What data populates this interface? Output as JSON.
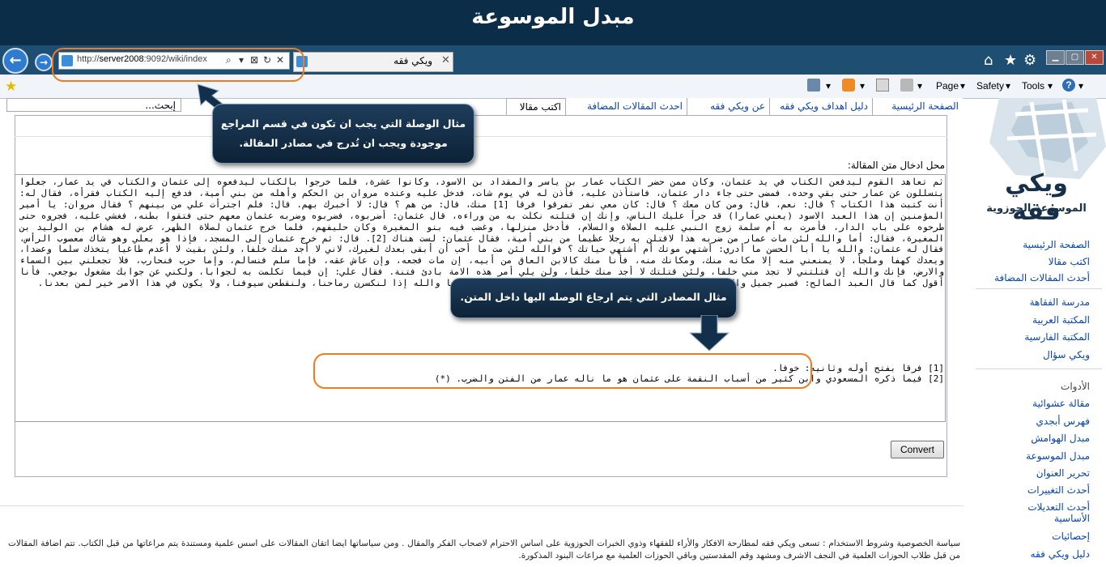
{
  "banner": {
    "title": "مبدل الموسوعة"
  },
  "browser": {
    "address_url_prefix": "http://",
    "address_url_host": "server2008",
    "address_url_rest": ":9092/wiki/index",
    "address_tools": [
      "⌕",
      "▾",
      "⊠",
      "↻",
      "✕"
    ],
    "tab_title": "ويكي فقه",
    "tab_close": "✕",
    "window_controls": [
      "▁",
      "▢",
      "✕"
    ],
    "commands": {
      "page_label": "Page",
      "safety_label": "Safety",
      "tools_label": "Tools",
      "help_label": "?",
      "dropdown_glyph": "▾"
    }
  },
  "logo": {
    "main": "ويكي فقه",
    "sub": "الموسوعة الحوزوية"
  },
  "search": {
    "value": "إبحث..."
  },
  "page_tabs": [
    {
      "label": "الصفحة الرئيسية"
    },
    {
      "label": "دليل اهداف ويكي فقه"
    },
    {
      "label": "عن ويكي فقه"
    },
    {
      "label": "احدث المقالات المضافة"
    },
    {
      "label": "اكتب مقالا"
    }
  ],
  "editor": {
    "field_label": "محل ادخال متن المقالة:",
    "article_text": "ثم تعاهد القوم ليدفعن الكتاب في يد عثمان، وكان ممن حضر الكتاب عمار بن ياسر والمقداد بن الاسود، وكانوا عشرة، فلما خرجوا بالكتاب ليدفعوه إلى عثمان والكتاب في يد عمار، جعلوا يتسللون عن عمار حتى بقي وحده، فمضى حتى جاء دار عثمان، فاستأذن عليه، فأذن له في يوم شات، فدخل عليه وعنده مروان بن الحكم وأهله من بني أمية، فدفع إليه الكتاب فقرأه، فقال له: أنت كتبت هذا الكتاب ؟ قال: نعم، قال: ومن كان معك ؟ قال: كان معي نفر تفرقوا فرقا [1] منك، قال: من هم ؟ قال: لا أخبرك بهم. قال: فلم اجترأت علي من بينهم ؟ فقال مروان: يا أمير المؤمنين إن هذا العبد الاسود (يعني عمارا) قد جرأ عليك الناس، وإنك إن قتلته نكلت به من وراءه، قال عثمان: أضربوه، فضربوه وضربه عثمان معهم حتى فتقوا بطنه، فغشي عليه، فجروه حتى طرحوه على باب الدار، فأمرت به أم سلمة زوج النبي عليه الصلاة والسلام، فأدخل منزلها، وغضب فيه بنو المغيرة وكان حليفهم، فلما خرج عثمان لصلاة الظهر، عرض له هشام بن الوليد بن المغيرة، فقال: أما والله لئن مات عمار من ضربه هذا لاقتلن به رجلا عظيما من بني أمية، فقال عثمان: لست هناك [2]. قال: ثم خرج عثمان إلى المسجد، فإذا هو بعلي وهو شاك معصوب الرأس، فقال له عثمان: والله يا أبا الحسن ما أدري: أشتهي موتك أم أشتهي حياتك ؟ فوالله لئن مت ما أحب أن أبقى بعدك لغيرك، لاني لا أجد منك خلفا، ولئن بقيت لا أعدم طاغيا يتخذك سلما وعضدا، ويعدك كهفا وملجأ، لا يمنعني منه إلا مكانه منك، ومكانك منه، فأنا منك كالابن العاق من أبيه، إن مات فجعه، وإن عاش عقه، فإما سلم فنسالم، وإما حرب فنحارب، فلا تجعلني بين السماء والارض، فإنك والله إن قتلتني لا تجد مني خلفا، ولئن قتلتك لا أجد منك خلفا، ولن يلي أمر هذه الامة بادئ فتنة. فقال علي: إن فيما تكلمت به لجوابا، ولكني عن جوابك مشغول بوجعي. فأنا أقول كما قال العبد الصالح: فصبر جميل والله المستعان على ما تصفون [ يوسف: 18 ]، قال مروان: إنا والله إذا لنكسرن رماحنا، ولنقطعن سيوفنا، ولا يكون في هذا الامر خير لمن بعدنا.",
    "refs": [
      "[1] فرقا بفتح أوله وثانيه: خوفا.",
      "[2] فيما ذكره المسعودي وابن كثير من أسباب النقمة على عثمان هو ما ناله عمار من الفتن والضرب. (*)"
    ],
    "convert_label": "Convert"
  },
  "sidebar": {
    "main_links": [
      {
        "label": "الصفحة الرئيسية"
      },
      {
        "label": "اكتب مقالا"
      },
      {
        "label": "أحدث المقالات المضافة"
      }
    ],
    "library_links": [
      {
        "label": "مدرسة الفقاهة"
      },
      {
        "label": "المكتبة العربية"
      },
      {
        "label": "المكتبة الفارسية"
      },
      {
        "label": "ويكي سؤال"
      }
    ],
    "tools_heading": "الأدوات",
    "tool_links": [
      {
        "label": "مقالة عشوائية"
      },
      {
        "label": "فهرس أبجدي"
      },
      {
        "label": "مبدل الهوامش"
      },
      {
        "label": "مبدل الموسوعة"
      },
      {
        "label": "تحرير العنوان"
      },
      {
        "label": "أحدث التغييرات"
      },
      {
        "label": "أحدث التعديلات الأساسية"
      },
      {
        "label": "إحصائيات"
      },
      {
        "label": "دليل ويكي فقه"
      }
    ]
  },
  "footer": {
    "text": "سياسة الخصوصية وشروط الاستخدام : تسعى ويكي فقه لمطارحة الافكار والأراء للفقهاء وذوي الخبرات الحوزوية على اساس الاحترام لاصحاب الفكر والمقال . ومن سياساتها ايضا اتقان المقالات على اسس علمية ومستندة يتم مراعاتها من قبل الكتاب. تتم اضافة المقالات من قبل طلاب الحوزات العلمية في النجف الاشرف ومشهد وقم المقدستين وباقي الحوزات العلمية مع مراعات البنود المذكورة."
  },
  "annotations": {
    "callout_link": "مثال الوصلة التي يجب ان تكون في قسم المراجع موجودة ويجب ان تُدرج في مصادر المقالة.",
    "callout_refs": "مثال المصادر التي يتم ارجاع الوصله اليها داخل المتن."
  },
  "colors": {
    "banner_bg": "#0c2d47",
    "accent_orange": "#f07a1c",
    "link_blue": "#0645ad",
    "callout_bg": "#12304b"
  },
  "icons": {
    "back": "←",
    "forward": "→",
    "home": "⌂",
    "favorites": "★",
    "settings": "⚙"
  }
}
